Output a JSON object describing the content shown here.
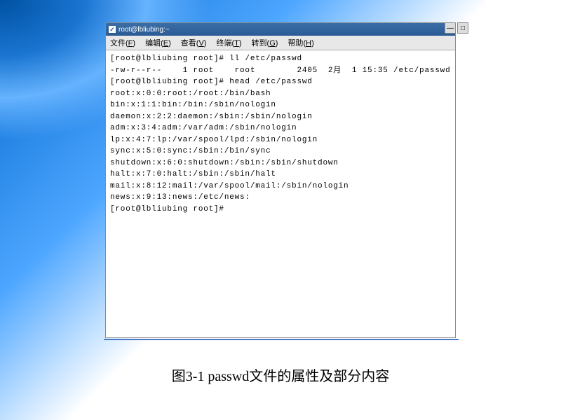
{
  "titlebar": {
    "title": "root@lbliubing:~"
  },
  "window_controls": {
    "minimize": "—",
    "maximize": "□"
  },
  "menubar": {
    "file": "文件",
    "file_key": "F",
    "edit": "编辑",
    "edit_key": "E",
    "view": "查看",
    "view_key": "V",
    "terminal": "终端",
    "terminal_key": "T",
    "go": "转到",
    "go_key": "G",
    "help": "帮助",
    "help_key": "H"
  },
  "terminal": {
    "lines": [
      "[root@lbliubing root]# ll /etc/passwd",
      "-rw-r--r--    1 root    root        2405  2月  1 15:35 /etc/passwd",
      "[root@lbliubing root]# head /etc/passwd",
      "root:x:0:0:root:/root:/bin/bash",
      "bin:x:1:1:bin:/bin:/sbin/nologin",
      "daemon:x:2:2:daemon:/sbin:/sbin/nologin",
      "adm:x:3:4:adm:/var/adm:/sbin/nologin",
      "lp:x:4:7:lp:/var/spool/lpd:/sbin/nologin",
      "sync:x:5:0:sync:/sbin:/bin/sync",
      "shutdown:x:6:0:shutdown:/sbin:/sbin/shutdown",
      "halt:x:7:0:halt:/sbin:/sbin/halt",
      "mail:x:8:12:mail:/var/spool/mail:/sbin/nologin",
      "news:x:9:13:news:/etc/news:",
      "[root@lbliubing root]#"
    ]
  },
  "caption": "图3-1  passwd文件的属性及部分内容"
}
